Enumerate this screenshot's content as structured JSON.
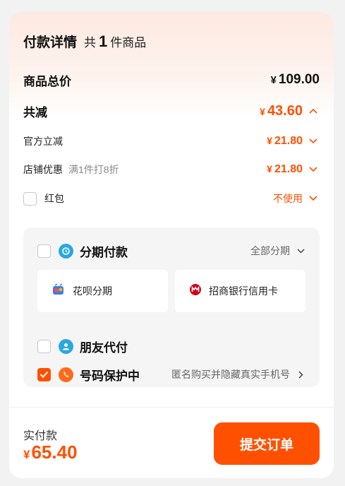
{
  "header": {
    "title": "付款详情",
    "count_prefix": "共",
    "count_number": "1",
    "count_suffix": "件商品"
  },
  "total": {
    "label": "商品总价",
    "currency": "¥",
    "amount": "109.00"
  },
  "discount_total": {
    "label": "共减",
    "currency": "¥",
    "amount": "43.60"
  },
  "official_discount": {
    "label": "官方立减",
    "currency": "¥",
    "amount": "21.80"
  },
  "store_discount": {
    "label": "店铺优惠",
    "desc": "满1件打8折",
    "currency": "¥",
    "amount": "21.80"
  },
  "red_packet": {
    "label": "红包",
    "value": "不使用",
    "checked": false
  },
  "payment_panel": {
    "installment": {
      "label": "分期付款",
      "link": "全部分期",
      "checked": false
    },
    "options": [
      {
        "label": "花呗分期",
        "icon": "huabei-icon"
      },
      {
        "label": "招商银行信用卡",
        "icon": "cmb-bank-icon"
      }
    ],
    "friend_pay": {
      "label": "朋友代付",
      "checked": false
    },
    "number_protect": {
      "label": "号码保护中",
      "desc": "匿名购买并隐藏真实手机号",
      "checked": true
    }
  },
  "footer": {
    "paid_label": "实付款",
    "currency": "¥",
    "paid_amount": "65.40",
    "submit_label": "提交订单"
  },
  "colors": {
    "accent": "#ff5000",
    "installment_icon": "#29a8e0",
    "friend_icon": "#29a8e0",
    "protect_icon": "#ff6a1a",
    "cmb_red": "#d0021b"
  }
}
